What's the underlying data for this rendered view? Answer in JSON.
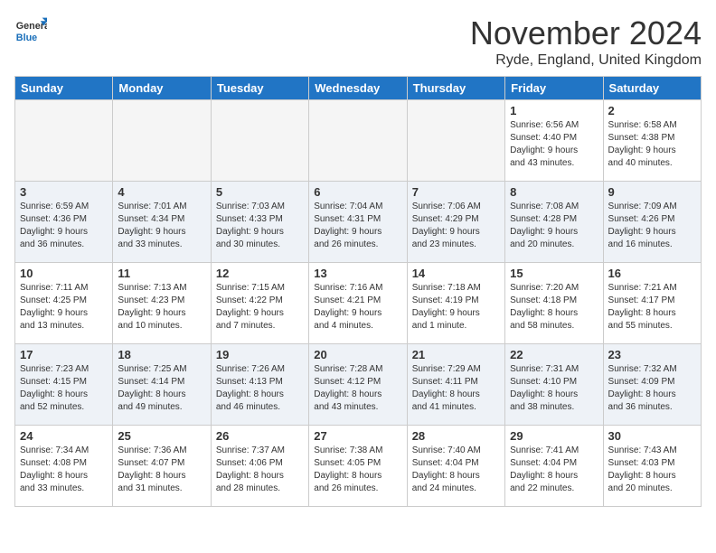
{
  "header": {
    "logo_general": "General",
    "logo_blue": "Blue",
    "month": "November 2024",
    "location": "Ryde, England, United Kingdom"
  },
  "days_of_week": [
    "Sunday",
    "Monday",
    "Tuesday",
    "Wednesday",
    "Thursday",
    "Friday",
    "Saturday"
  ],
  "weeks": [
    [
      {
        "day": "",
        "info": ""
      },
      {
        "day": "",
        "info": ""
      },
      {
        "day": "",
        "info": ""
      },
      {
        "day": "",
        "info": ""
      },
      {
        "day": "",
        "info": ""
      },
      {
        "day": "1",
        "info": "Sunrise: 6:56 AM\nSunset: 4:40 PM\nDaylight: 9 hours\nand 43 minutes."
      },
      {
        "day": "2",
        "info": "Sunrise: 6:58 AM\nSunset: 4:38 PM\nDaylight: 9 hours\nand 40 minutes."
      }
    ],
    [
      {
        "day": "3",
        "info": "Sunrise: 6:59 AM\nSunset: 4:36 PM\nDaylight: 9 hours\nand 36 minutes."
      },
      {
        "day": "4",
        "info": "Sunrise: 7:01 AM\nSunset: 4:34 PM\nDaylight: 9 hours\nand 33 minutes."
      },
      {
        "day": "5",
        "info": "Sunrise: 7:03 AM\nSunset: 4:33 PM\nDaylight: 9 hours\nand 30 minutes."
      },
      {
        "day": "6",
        "info": "Sunrise: 7:04 AM\nSunset: 4:31 PM\nDaylight: 9 hours\nand 26 minutes."
      },
      {
        "day": "7",
        "info": "Sunrise: 7:06 AM\nSunset: 4:29 PM\nDaylight: 9 hours\nand 23 minutes."
      },
      {
        "day": "8",
        "info": "Sunrise: 7:08 AM\nSunset: 4:28 PM\nDaylight: 9 hours\nand 20 minutes."
      },
      {
        "day": "9",
        "info": "Sunrise: 7:09 AM\nSunset: 4:26 PM\nDaylight: 9 hours\nand 16 minutes."
      }
    ],
    [
      {
        "day": "10",
        "info": "Sunrise: 7:11 AM\nSunset: 4:25 PM\nDaylight: 9 hours\nand 13 minutes."
      },
      {
        "day": "11",
        "info": "Sunrise: 7:13 AM\nSunset: 4:23 PM\nDaylight: 9 hours\nand 10 minutes."
      },
      {
        "day": "12",
        "info": "Sunrise: 7:15 AM\nSunset: 4:22 PM\nDaylight: 9 hours\nand 7 minutes."
      },
      {
        "day": "13",
        "info": "Sunrise: 7:16 AM\nSunset: 4:21 PM\nDaylight: 9 hours\nand 4 minutes."
      },
      {
        "day": "14",
        "info": "Sunrise: 7:18 AM\nSunset: 4:19 PM\nDaylight: 9 hours\nand 1 minute."
      },
      {
        "day": "15",
        "info": "Sunrise: 7:20 AM\nSunset: 4:18 PM\nDaylight: 8 hours\nand 58 minutes."
      },
      {
        "day": "16",
        "info": "Sunrise: 7:21 AM\nSunset: 4:17 PM\nDaylight: 8 hours\nand 55 minutes."
      }
    ],
    [
      {
        "day": "17",
        "info": "Sunrise: 7:23 AM\nSunset: 4:15 PM\nDaylight: 8 hours\nand 52 minutes."
      },
      {
        "day": "18",
        "info": "Sunrise: 7:25 AM\nSunset: 4:14 PM\nDaylight: 8 hours\nand 49 minutes."
      },
      {
        "day": "19",
        "info": "Sunrise: 7:26 AM\nSunset: 4:13 PM\nDaylight: 8 hours\nand 46 minutes."
      },
      {
        "day": "20",
        "info": "Sunrise: 7:28 AM\nSunset: 4:12 PM\nDaylight: 8 hours\nand 43 minutes."
      },
      {
        "day": "21",
        "info": "Sunrise: 7:29 AM\nSunset: 4:11 PM\nDaylight: 8 hours\nand 41 minutes."
      },
      {
        "day": "22",
        "info": "Sunrise: 7:31 AM\nSunset: 4:10 PM\nDaylight: 8 hours\nand 38 minutes."
      },
      {
        "day": "23",
        "info": "Sunrise: 7:32 AM\nSunset: 4:09 PM\nDaylight: 8 hours\nand 36 minutes."
      }
    ],
    [
      {
        "day": "24",
        "info": "Sunrise: 7:34 AM\nSunset: 4:08 PM\nDaylight: 8 hours\nand 33 minutes."
      },
      {
        "day": "25",
        "info": "Sunrise: 7:36 AM\nSunset: 4:07 PM\nDaylight: 8 hours\nand 31 minutes."
      },
      {
        "day": "26",
        "info": "Sunrise: 7:37 AM\nSunset: 4:06 PM\nDaylight: 8 hours\nand 28 minutes."
      },
      {
        "day": "27",
        "info": "Sunrise: 7:38 AM\nSunset: 4:05 PM\nDaylight: 8 hours\nand 26 minutes."
      },
      {
        "day": "28",
        "info": "Sunrise: 7:40 AM\nSunset: 4:04 PM\nDaylight: 8 hours\nand 24 minutes."
      },
      {
        "day": "29",
        "info": "Sunrise: 7:41 AM\nSunset: 4:04 PM\nDaylight: 8 hours\nand 22 minutes."
      },
      {
        "day": "30",
        "info": "Sunrise: 7:43 AM\nSunset: 4:03 PM\nDaylight: 8 hours\nand 20 minutes."
      }
    ]
  ]
}
